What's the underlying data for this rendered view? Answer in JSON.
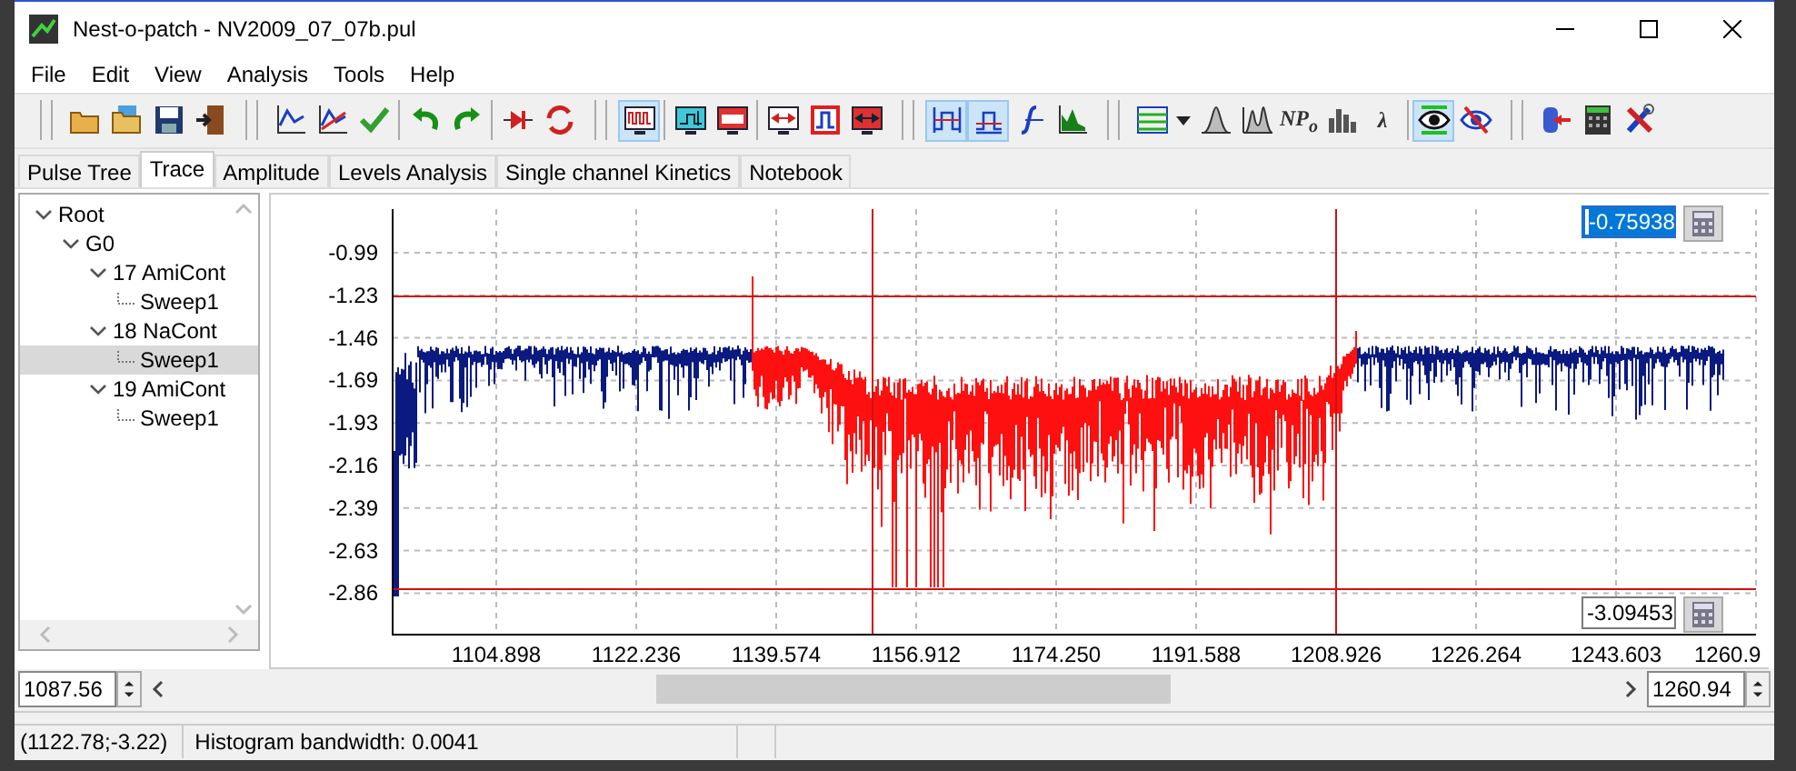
{
  "window": {
    "title": "Nest-o-patch - NV2009_07_07b.pul"
  },
  "menu": [
    "File",
    "Edit",
    "View",
    "Analysis",
    "Tools",
    "Help"
  ],
  "toolbar": [
    {
      "kind": "grip"
    },
    {
      "kind": "open",
      "pressed": false
    },
    {
      "kind": "open-alt",
      "pressed": false
    },
    {
      "kind": "save",
      "pressed": false
    },
    {
      "kind": "exit",
      "pressed": false
    },
    {
      "kind": "grip"
    },
    {
      "kind": "trace-blue",
      "pressed": false
    },
    {
      "kind": "trace-red",
      "pressed": false
    },
    {
      "kind": "check",
      "pressed": false
    },
    {
      "kind": "sep"
    },
    {
      "kind": "undo",
      "pressed": false
    },
    {
      "kind": "redo",
      "pressed": false
    },
    {
      "kind": "sep"
    },
    {
      "kind": "diode",
      "pressed": false
    },
    {
      "kind": "converter",
      "pressed": false
    },
    {
      "kind": "grip"
    },
    {
      "kind": "monitor",
      "pressed": true
    },
    {
      "kind": "sep"
    },
    {
      "kind": "monitor-arrows",
      "pressed": false
    },
    {
      "kind": "monitor-red",
      "pressed": false
    },
    {
      "kind": "sep"
    },
    {
      "kind": "fit-width",
      "pressed": false
    },
    {
      "kind": "pulse",
      "pressed": false
    },
    {
      "kind": "fit-red",
      "pressed": false
    },
    {
      "kind": "grip"
    },
    {
      "kind": "step",
      "pressed": true
    },
    {
      "kind": "step-alt",
      "pressed": true
    },
    {
      "kind": "integral",
      "pressed": false
    },
    {
      "kind": "histogram",
      "pressed": false
    },
    {
      "kind": "grip"
    },
    {
      "kind": "lines",
      "pressed": false
    },
    {
      "kind": "dropdown",
      "pressed": false
    },
    {
      "kind": "peak",
      "pressed": false
    },
    {
      "kind": "double-peak",
      "pressed": false
    },
    {
      "kind": "np",
      "label": "NP$_{o}$",
      "pressed": false
    },
    {
      "kind": "bars",
      "pressed": false
    },
    {
      "kind": "decay",
      "label": "λ",
      "pressed": false
    },
    {
      "kind": "sep"
    },
    {
      "kind": "eye",
      "pressed": true
    },
    {
      "kind": "eye-crossed",
      "pressed": false
    },
    {
      "kind": "grip"
    },
    {
      "kind": "plug",
      "pressed": false
    },
    {
      "kind": "calculator",
      "pressed": false
    },
    {
      "kind": "tools",
      "pressed": false
    }
  ],
  "tabs": [
    {
      "label": "Pulse Tree",
      "selected": false
    },
    {
      "label": "Trace",
      "selected": true
    },
    {
      "label": "Amplitude",
      "selected": false
    },
    {
      "label": "Levels Analysis",
      "selected": false
    },
    {
      "label": "Single channel Kinetics",
      "selected": false
    },
    {
      "label": "Notebook",
      "selected": false
    }
  ],
  "tree": [
    {
      "label": "Root",
      "expanded": true,
      "selected": false,
      "children": [
        {
          "label": "G0",
          "expanded": true,
          "selected": false,
          "children": [
            {
              "label": "17 AmiCont",
              "expanded": true,
              "selected": false,
              "children": [
                {
                  "label": "Sweep1",
                  "selected": false
                }
              ]
            },
            {
              "label": "18 NaCont",
              "expanded": true,
              "selected": false,
              "children": [
                {
                  "label": "Sweep1",
                  "selected": true
                }
              ]
            },
            {
              "label": "19 AmiCont",
              "expanded": true,
              "selected": false,
              "children": [
                {
                  "label": "Sweep1",
                  "selected": false
                }
              ]
            }
          ]
        }
      ]
    }
  ],
  "chart": {
    "y_labels": [
      "-0.99",
      "-1.23",
      "-1.46",
      "-1.69",
      "-1.93",
      "-2.16",
      "-2.39",
      "-2.63",
      "-2.86"
    ],
    "x_labels": [
      "1104.898",
      "1122.236",
      "1139.574",
      "1156.912",
      "1174.250",
      "1191.588",
      "1208.926",
      "1226.264",
      "1243.603",
      "1260.9"
    ],
    "upper_cursor": {
      "value": "-0.75938",
      "selected": true
    },
    "lower_cursor": {
      "value": "-3.09453",
      "selected": false
    }
  },
  "range": {
    "start": "1087.56",
    "end": "1260.94"
  },
  "status_bar": [
    "(1122.78;-3.22)",
    "Histogram bandwidth: 0.0041"
  ]
}
